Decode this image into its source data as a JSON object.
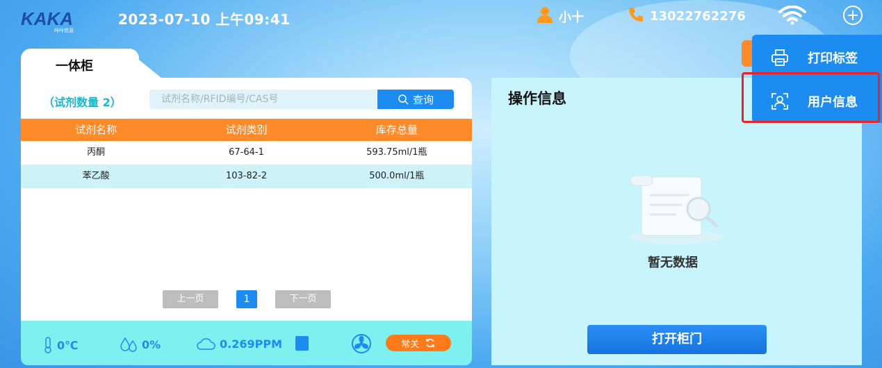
{
  "header": {
    "logo_text": "KAKA",
    "logo_sub": "咔咔信息",
    "datetime": "2023-07-10 上午09:41",
    "user_name": "小十",
    "phone": "13022762276"
  },
  "left_panel": {
    "tab_label": "一体柜",
    "reagent_count": "（试剂数量 2）",
    "search_placeholder": "试剂名称/RFID编号/CAS号",
    "search_button": "查询",
    "columns": [
      "试剂名称",
      "试剂类别",
      "库存总量"
    ],
    "rows": [
      [
        "丙酮",
        "67-64-1",
        "593.75ml/1瓶"
      ],
      [
        "苯乙酸",
        "103-82-2",
        "500.0ml/1瓶"
      ]
    ],
    "pager": {
      "prev": "上一页",
      "current": "1",
      "next": "下一页"
    }
  },
  "status": {
    "temperature": "0℃",
    "humidity": "0%",
    "ppm": "0.269PPM",
    "mode_label": "常关"
  },
  "right_panel": {
    "title": "操作信息",
    "empty_text": "暂无数据",
    "open_button": "打开柜门"
  },
  "dropdown": {
    "items": [
      {
        "label": "打印标签",
        "icon": "printer-icon"
      },
      {
        "label": "用户信息",
        "icon": "user-scan-icon"
      }
    ]
  },
  "colors": {
    "accent_blue": "#1d8cf0",
    "accent_orange": "#ff8a29",
    "teal_text": "#19b8c9",
    "highlight_red": "#e8242a"
  }
}
